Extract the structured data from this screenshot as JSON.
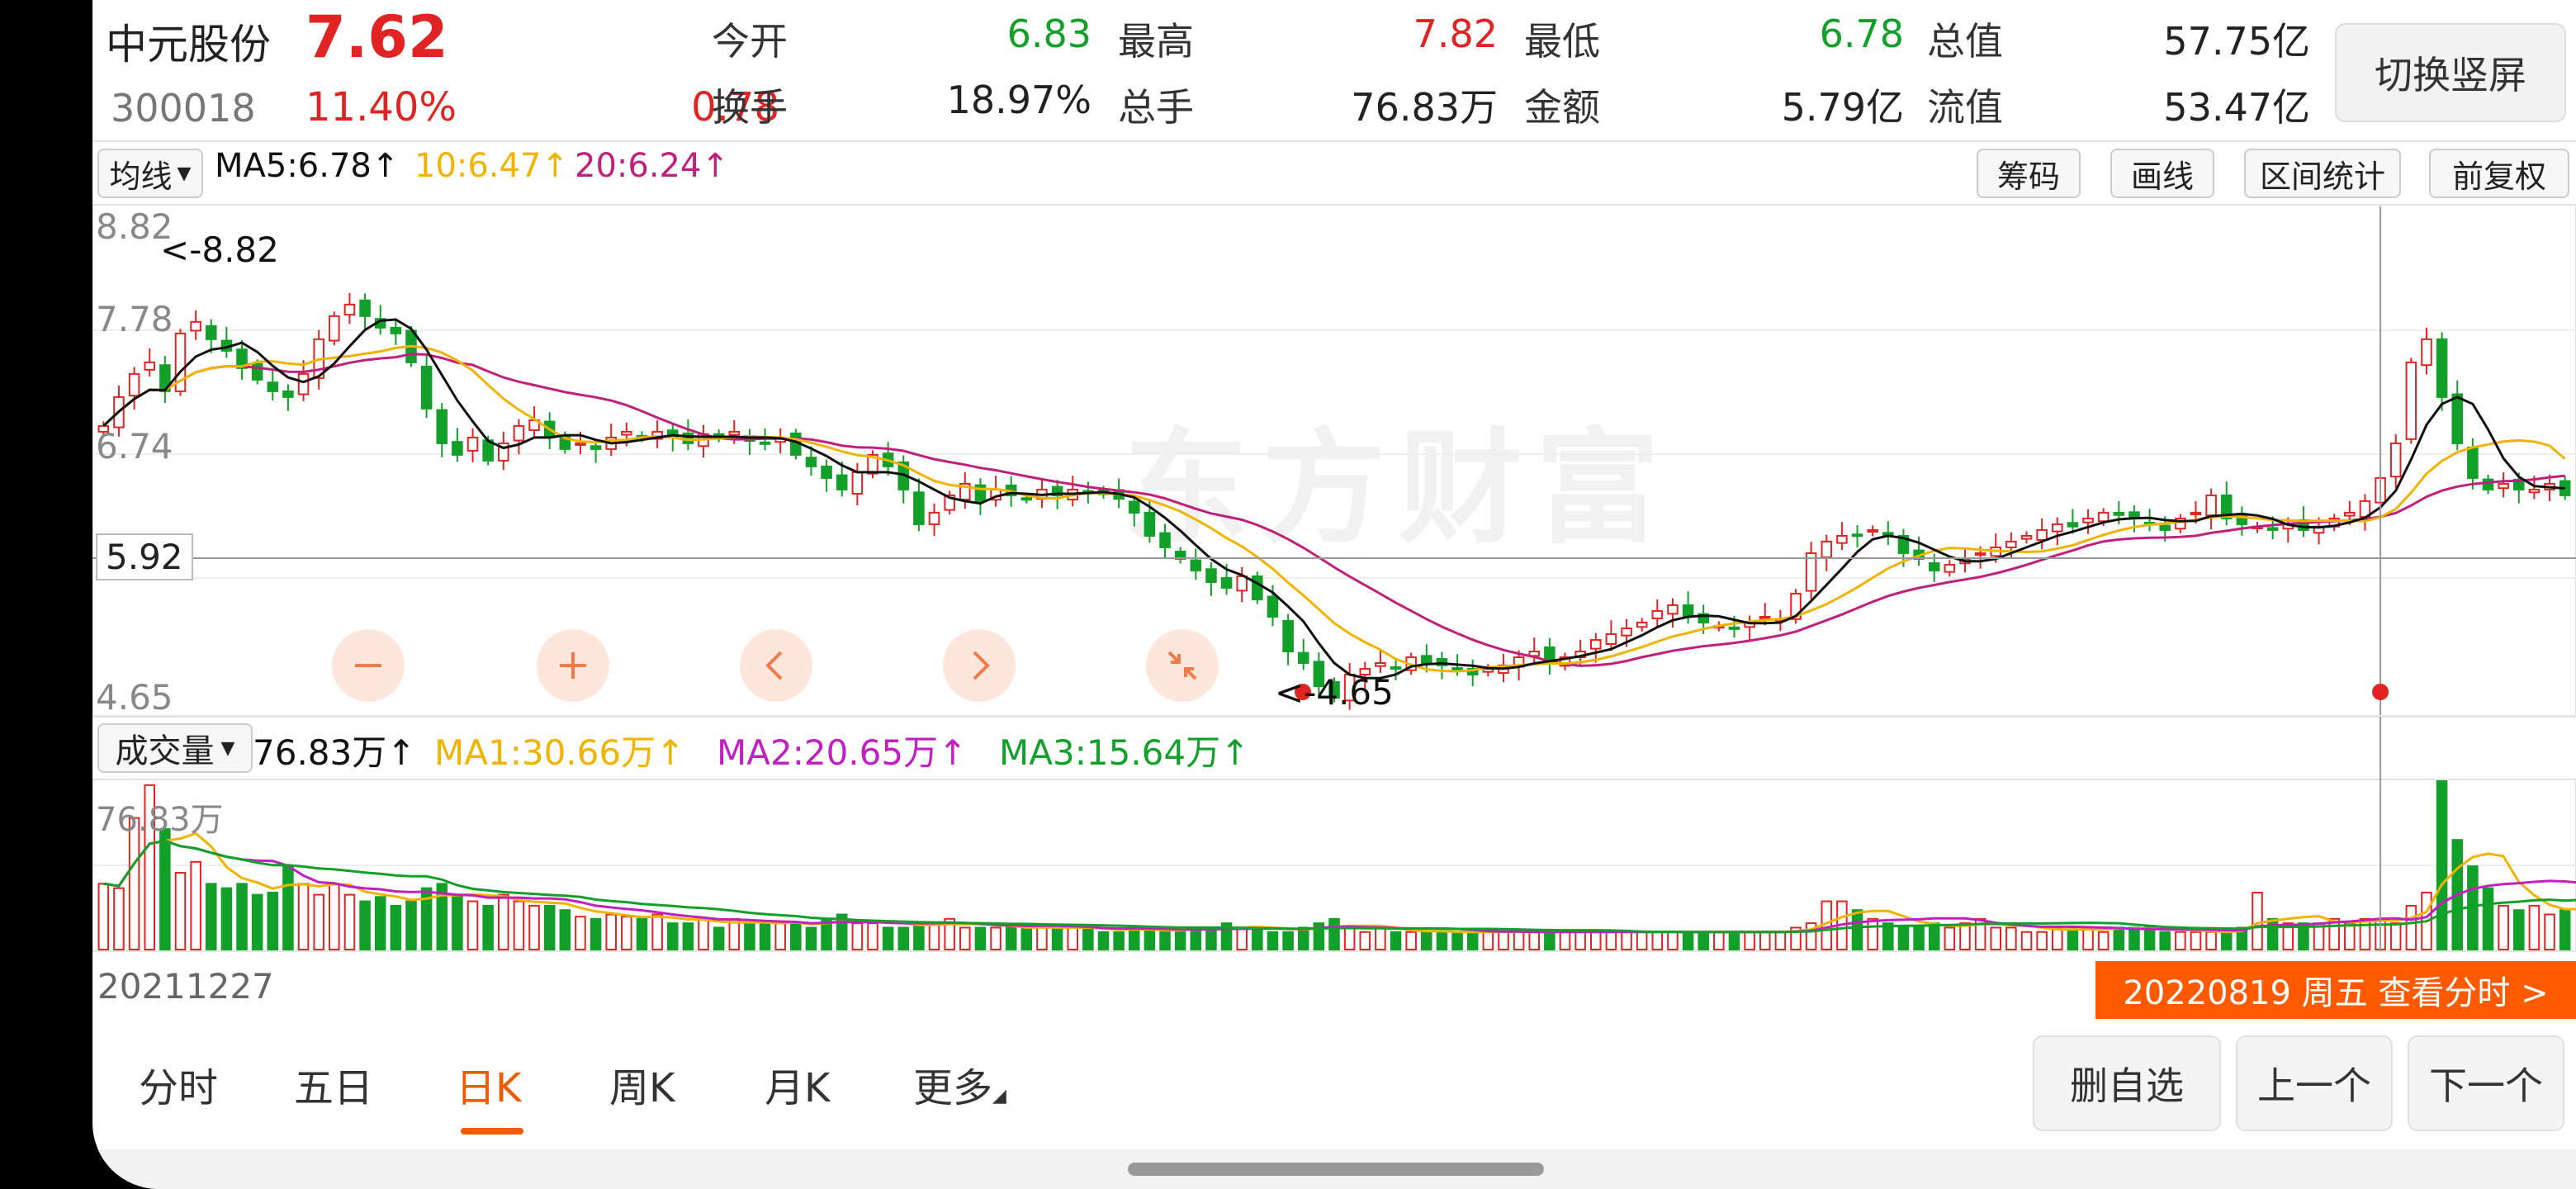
{
  "stock": {
    "name": "中元股份",
    "code": "300018",
    "price": "7.62",
    "change_pct": "11.40%",
    "change": "0.78"
  },
  "quote": [
    {
      "label": "今开",
      "value": "6.83",
      "color": "#12a02a"
    },
    {
      "label": "最高",
      "value": "7.82",
      "color": "#e02323"
    },
    {
      "label": "最低",
      "value": "6.78",
      "color": "#12a02a"
    },
    {
      "label": "总值",
      "value": "57.75亿",
      "color": "#222222"
    },
    {
      "label": "换手",
      "value": "18.97%",
      "color": "#222222"
    },
    {
      "label": "总手",
      "value": "76.83万",
      "color": "#222222"
    },
    {
      "label": "金额",
      "value": "5.79亿",
      "color": "#222222"
    },
    {
      "label": "流值",
      "value": "53.47亿",
      "color": "#222222"
    }
  ],
  "switch_button": "切换竖屏",
  "ma_bar": {
    "selector": "均线",
    "ma5": "MA5:6.78",
    "ma10": "10:6.47",
    "ma20": "20:6.24",
    "buttons": [
      "筹码",
      "画线",
      "区间统计",
      "前复权"
    ]
  },
  "price_axis": {
    "top": "8.82",
    "upper": "7.78",
    "mid": "6.74",
    "cursor": "5.92",
    "low": "4.65"
  },
  "annotations": {
    "high": "<-8.82",
    "low": "<-4.65"
  },
  "volume_bar": {
    "selector": "成交量",
    "current": "76.83万",
    "ma1": "MA1:30.66万",
    "ma2": "MA2:20.65万",
    "ma3": "MA3:15.64万",
    "axis_top": "76.83万"
  },
  "dates": {
    "start": "20211227",
    "tooltip": "20220819 周五 查看分时 >"
  },
  "tabs": [
    "分时",
    "五日",
    "日K",
    "周K",
    "月K",
    "更多"
  ],
  "active_tab": 2,
  "bottom_buttons": [
    "删自选",
    "上一个",
    "下一个"
  ],
  "watermark": "东方财富",
  "colors": {
    "up": "#e02323",
    "down": "#12a02a",
    "ma5": "#111111",
    "ma10": "#f0b400",
    "ma20": "#c0207a",
    "vol_ma1": "#f0b400",
    "vol_ma2": "#c020c0",
    "vol_ma3": "#12a02a",
    "accent": "#f05a00"
  },
  "chart_data": {
    "type": "candlestick",
    "price_range": [
      4.65,
      8.82
    ],
    "closes": [
      7.05,
      7.3,
      7.5,
      7.6,
      7.35,
      7.85,
      7.95,
      7.8,
      7.7,
      7.55,
      7.45,
      7.35,
      7.3,
      7.5,
      7.8,
      8.0,
      8.1,
      8.0,
      7.9,
      7.85,
      7.6,
      7.2,
      6.9,
      6.8,
      6.95,
      6.75,
      6.9,
      7.05,
      7.1,
      6.95,
      6.85,
      6.9,
      6.85,
      6.95,
      7.0,
      6.95,
      7.0,
      6.95,
      6.9,
      6.98,
      6.95,
      7.0,
      6.92,
      6.9,
      6.95,
      6.8,
      6.7,
      6.6,
      6.5,
      6.65,
      6.8,
      6.7,
      6.5,
      6.2,
      6.3,
      6.45,
      6.55,
      6.4,
      6.5,
      6.45,
      6.42,
      6.5,
      6.45,
      6.5,
      6.48,
      6.46,
      6.42,
      6.3,
      6.1,
      6.0,
      5.9,
      5.8,
      5.7,
      5.65,
      5.75,
      5.55,
      5.4,
      5.1,
      5.0,
      4.8,
      4.7,
      4.9,
      4.95,
      5.0,
      4.95,
      5.05,
      5.0,
      4.98,
      4.95,
      4.9,
      4.95,
      4.98,
      5.05,
      5.1,
      5.0,
      5.05,
      5.1,
      5.2,
      5.25,
      5.3,
      5.35,
      5.45,
      5.5,
      5.4,
      5.35,
      5.32,
      5.3,
      5.35,
      5.4,
      5.38,
      5.6,
      5.95,
      6.05,
      6.1,
      6.1,
      6.15,
      6.1,
      5.95,
      5.9,
      5.8,
      5.85,
      5.9,
      5.95,
      6.0,
      6.05,
      6.1,
      6.15,
      6.2,
      6.18,
      6.25,
      6.3,
      6.28,
      6.25,
      6.2,
      6.15,
      6.25,
      6.3,
      6.45,
      6.25,
      6.2,
      6.18,
      6.15,
      6.2,
      6.15,
      6.18,
      6.25,
      6.3,
      6.4,
      6.6,
      6.9,
      7.6,
      7.8,
      7.3,
      6.9,
      6.6,
      6.5,
      6.55,
      6.5,
      6.5,
      6.55,
      6.45
    ],
    "volume_range": [
      0,
      76.83
    ],
    "volumes": [
      30,
      28,
      60,
      75,
      55,
      35,
      40,
      30,
      28,
      30,
      25,
      26,
      38,
      30,
      25,
      30,
      25,
      22,
      24,
      20,
      22,
      28,
      30,
      24,
      22,
      20,
      25,
      22,
      20,
      20,
      18,
      15,
      14,
      16,
      15,
      14,
      16,
      12,
      12,
      14,
      10,
      14,
      12,
      12,
      12,
      12,
      10,
      14,
      16,
      12,
      12,
      10,
      10,
      12,
      12,
      14,
      10,
      10,
      10,
      10,
      10,
      10,
      10,
      10,
      10,
      8,
      8,
      10,
      10,
      8,
      8,
      10,
      10,
      12,
      10,
      10,
      8,
      8,
      10,
      12,
      14,
      10,
      8,
      10,
      8,
      8,
      8,
      8,
      8,
      8,
      8,
      8,
      8,
      8,
      8,
      8,
      8,
      8,
      8,
      8,
      8,
      8,
      8,
      8,
      8,
      8,
      8,
      8,
      8,
      8,
      10,
      12,
      22,
      22,
      18,
      14,
      12,
      10,
      10,
      12,
      10,
      12,
      14,
      10,
      10,
      8,
      8,
      10,
      10,
      10,
      8,
      10,
      10,
      10,
      8,
      8,
      8,
      8,
      8,
      10,
      26,
      14,
      12,
      12,
      12,
      14,
      12,
      14,
      14,
      12,
      20,
      26,
      76.83,
      50,
      38,
      28,
      20,
      18,
      20,
      16,
      18,
      20
    ],
    "ma_values": {
      "MA5": 6.78,
      "MA10": 6.47,
      "MA20": 6.24
    },
    "volume_ma_values": {
      "MA1": 30.66,
      "MA2": 20.65,
      "MA3": 15.64
    }
  }
}
